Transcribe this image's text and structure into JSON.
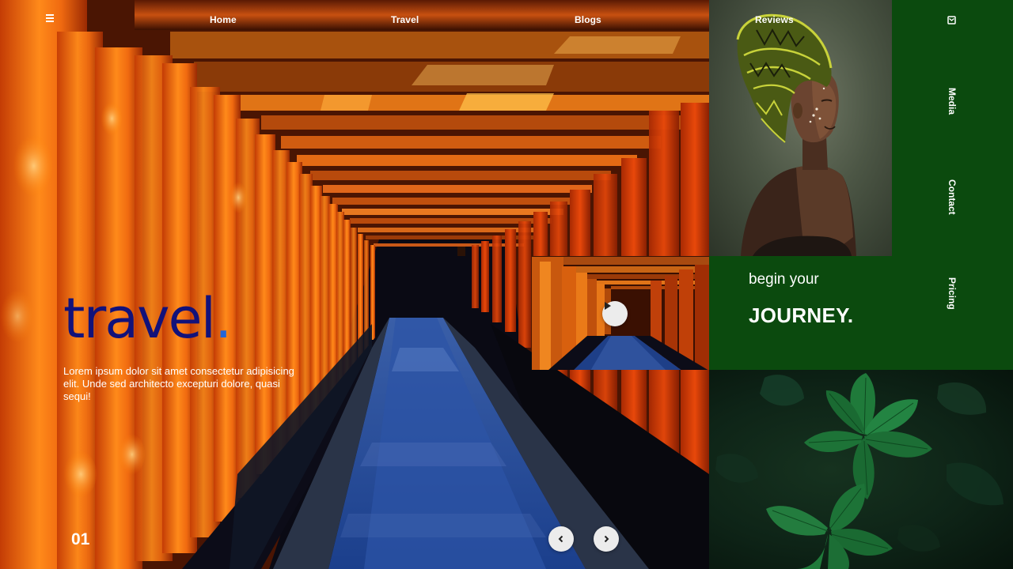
{
  "nav": {
    "items": [
      "Home",
      "Travel",
      "Blogs",
      "Reviews"
    ]
  },
  "hero": {
    "title": "travel",
    "title_dot": ".",
    "description": "Lorem ipsum dolor sit amet consectetur adipisicing elit. Unde sed architecto excepturi dolore, quasi sequi!",
    "slide_number": "01"
  },
  "panel": {
    "subtitle": "begin your",
    "headline": "JOURNEY."
  },
  "side_nav": {
    "items": [
      "Media",
      "Contact",
      "Pricing"
    ]
  },
  "colors": {
    "panel_green": "#0b4a0e",
    "title_navy": "#12127a",
    "title_dot_blue": "#2466d8",
    "torii_orange": "#e8600c"
  },
  "icons": {
    "menu": "hamburger-icon",
    "mail": "mail-icon",
    "play": "play-icon",
    "prev": "chevron-left-icon",
    "next": "chevron-right-icon"
  }
}
